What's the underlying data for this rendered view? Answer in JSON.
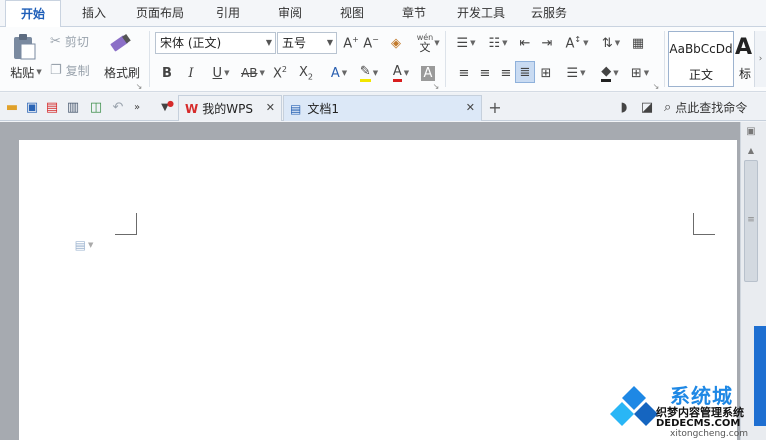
{
  "menu": {
    "tabs": [
      {
        "label": "开始"
      },
      {
        "label": "插入"
      },
      {
        "label": "页面布局"
      },
      {
        "label": "引用"
      },
      {
        "label": "审阅"
      },
      {
        "label": "视图"
      },
      {
        "label": "章节"
      },
      {
        "label": "开发工具"
      },
      {
        "label": "云服务"
      }
    ]
  },
  "ribbon": {
    "clipboard": {
      "paste": "粘贴",
      "cut": "剪切",
      "copy": "复制",
      "format_painter": "格式刷"
    },
    "font": {
      "name": "宋体 (正文)",
      "size": "五号",
      "wen_glyph": "wén",
      "wen_char": "文"
    },
    "styles": {
      "normal_preview": "AaBbCcDd",
      "normal_label": "正文",
      "heading_preview": "A",
      "heading_label_partial": "标"
    }
  },
  "quickbar": {
    "tabs": [
      {
        "label": "我的WPS"
      },
      {
        "label": "文档1"
      }
    ],
    "search": "点此查找命令"
  },
  "watermark": {
    "brand": "系统城",
    "subtitle": "织梦内容管理系统",
    "site1": "DEDECMS.COM",
    "site2": "xitongcheng.com"
  }
}
